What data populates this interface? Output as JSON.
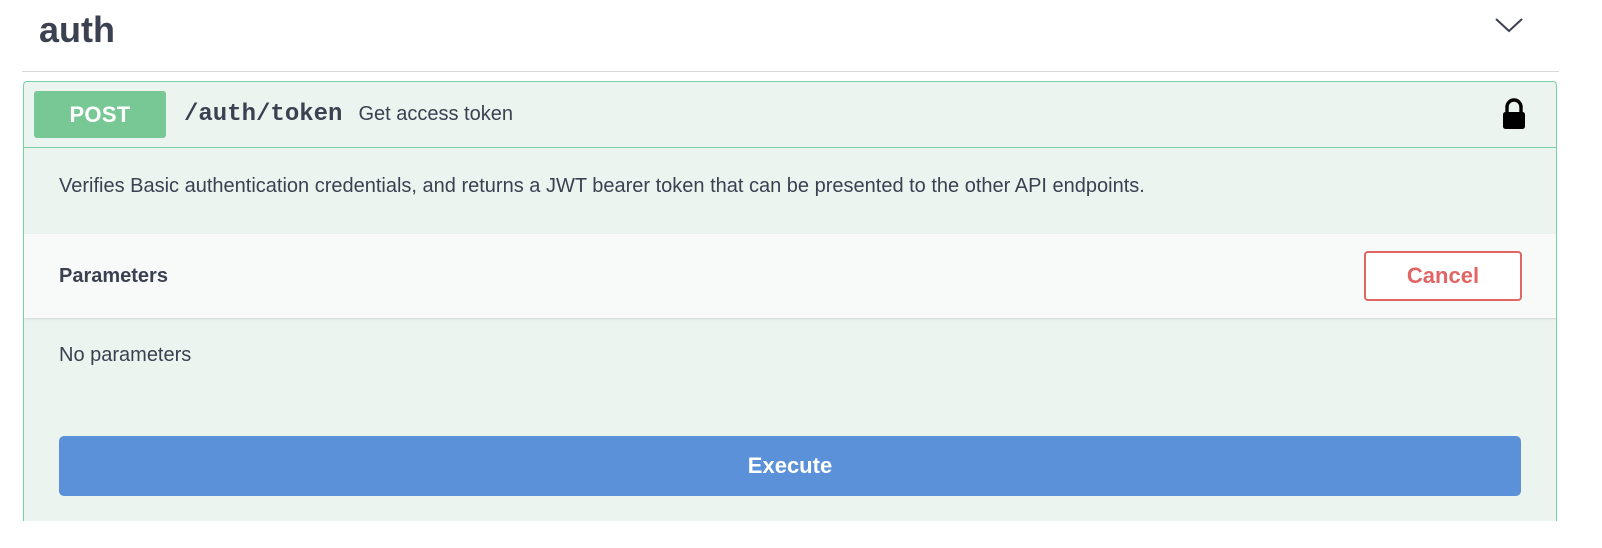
{
  "tag": {
    "title": "auth",
    "toggle_icon": "chevron-down-icon"
  },
  "operation": {
    "method": "POST",
    "path": "/auth/token",
    "summary": "Get access token",
    "lock_icon": "lock-icon",
    "description": "Verifies Basic authentication credentials, and returns a JWT bearer token that can be presented to the other API endpoints.",
    "parameters_title": "Parameters",
    "cancel_label": "Cancel",
    "no_parameters_text": "No parameters",
    "execute_label": "Execute"
  },
  "colors": {
    "method_bg": "#78c895",
    "block_border": "#78d1a5",
    "block_bg": "#ebf4ef",
    "cancel": "#e06666",
    "execute_bg": "#5b91d8",
    "text": "#3b4151"
  }
}
